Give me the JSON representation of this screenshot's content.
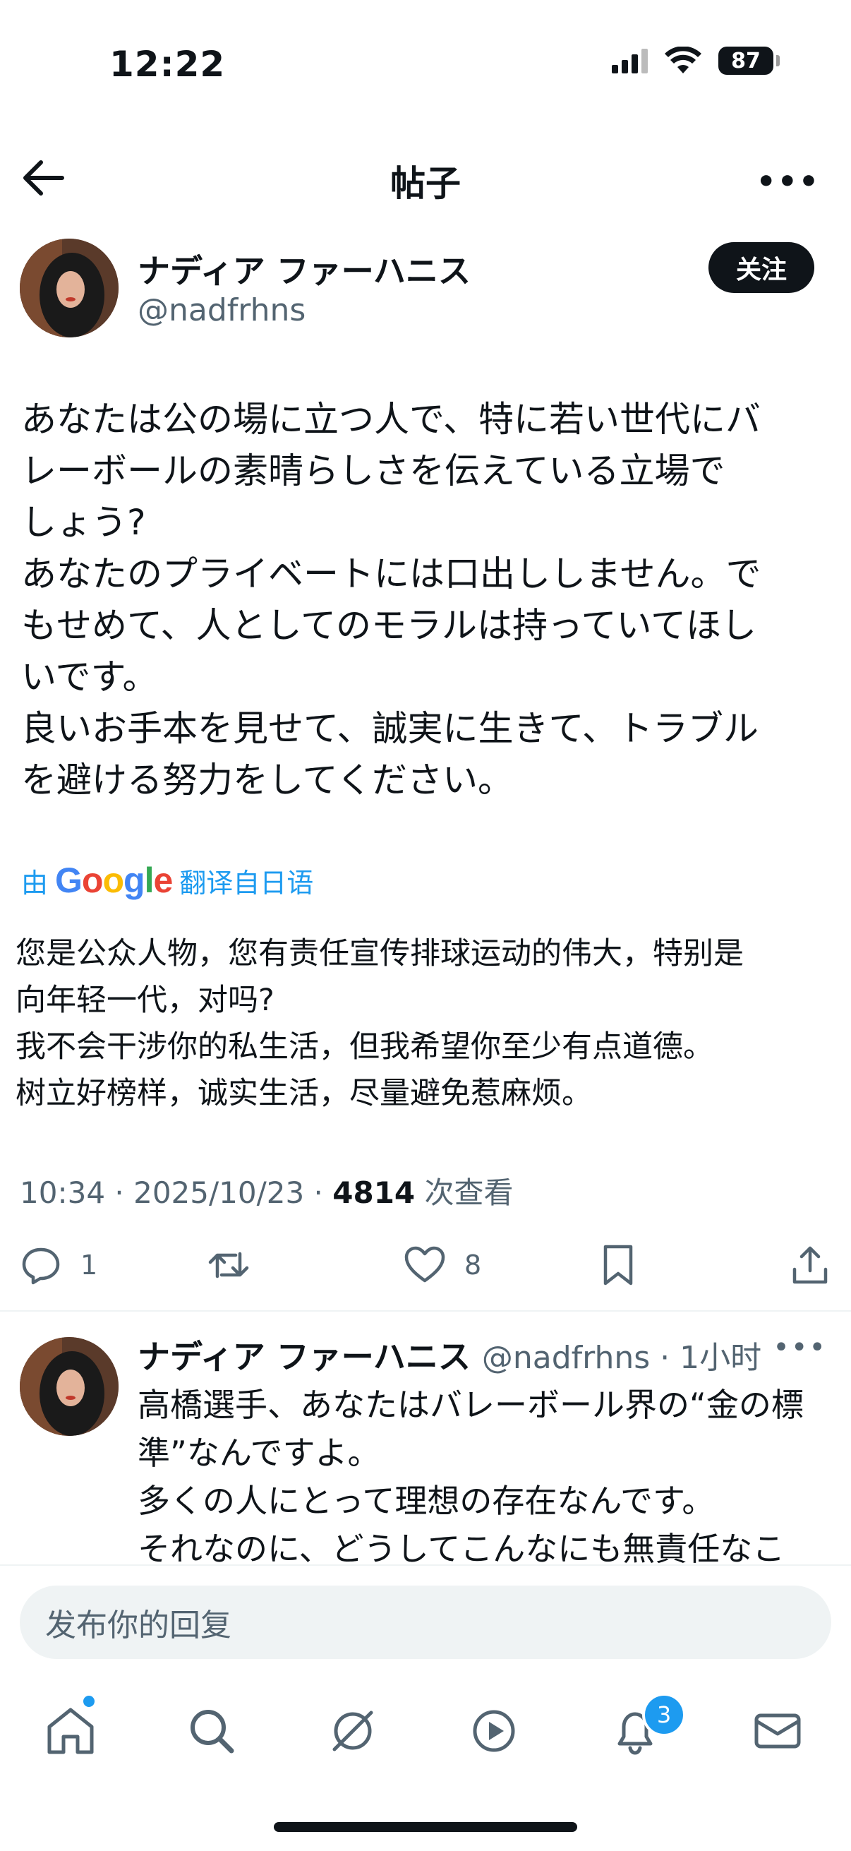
{
  "status_bar": {
    "time": "12:22",
    "battery": "87"
  },
  "header": {
    "title": "帖子"
  },
  "post": {
    "author_name": "ナディア ファーハニス",
    "author_handle": "@nadfrhns",
    "follow_label": "关注",
    "text": "あなたは公の場に立つ人で、特に若い世代にバ\nレーボールの素晴らしさを伝えている立場で\nしょう?\nあなたのプライベートには口出ししません。で\nもせめて、人としてのモラルは持っていてほし\nいです。\n良いお手本を見せて、誠実に生きて、トラブル\nを避ける努力をしてください。",
    "translate_prefix": "由",
    "translate_brand": "Google",
    "translate_suffix": "翻译自日语",
    "translated_text": "您是公众人物，您有责任宣传排球运动的伟大，特别是\n向年轻一代，对吗?\n我不会干涉你的私生活，但我希望你至少有点道德。\n树立好榜样，诚实生活，尽量避免惹麻烦。",
    "time": "10:34",
    "date": "2025/10/23",
    "views": "4814",
    "views_label": "次查看",
    "reply_count": "1",
    "like_count": "8"
  },
  "reply": {
    "author_name": "ナディア ファーハニス",
    "author_handle": "@nadfrhns",
    "time_ago": "1小时",
    "text": "高橋選手、あなたはバレーボール界の“金の標\n準”なんですよ。\n多くの人にとって理想の存在なんです。\nそれなのに、どうしてこんなにも無責任なこ"
  },
  "compose": {
    "placeholder": "发布你的回复"
  },
  "tab_bar": {
    "notification_badge": "3"
  },
  "colors": {
    "accent": "#1d9bf0",
    "text": "#0f1419",
    "secondary": "#536471"
  }
}
